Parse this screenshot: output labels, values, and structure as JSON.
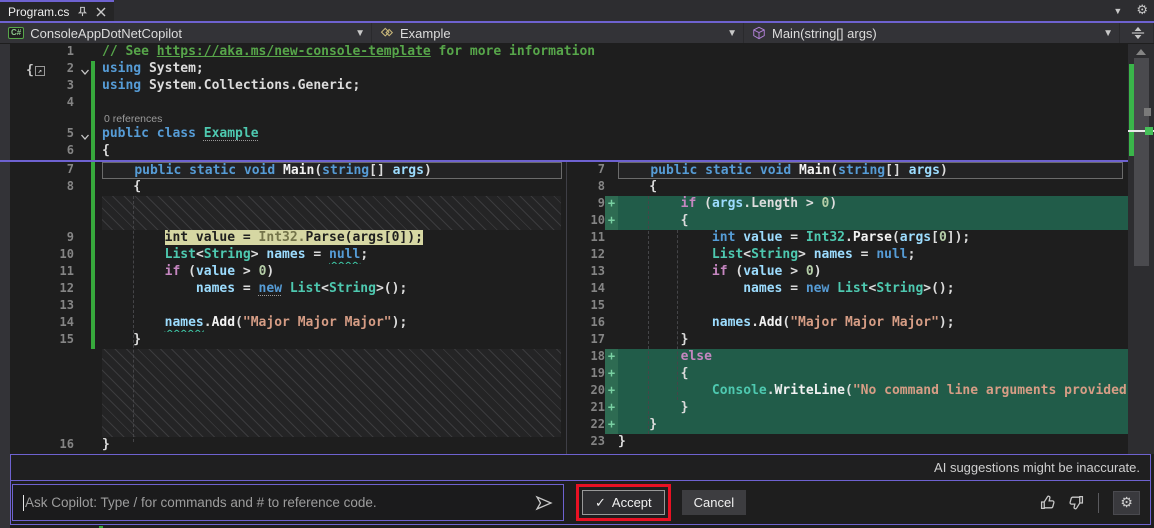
{
  "window": {
    "tab_title": "Program.cs",
    "tab_icons": [
      "pin-icon",
      "close-icon"
    ],
    "tabbar_right_icons": [
      "chevron-down-icon",
      "gear-icon"
    ]
  },
  "navbar": {
    "project": "ConsoleAppDotNetCopilot",
    "project_icon": "C#",
    "class": "Example",
    "class_icon": "class-icon",
    "method": "Main(string[] args)",
    "method_icon": "method-cube-icon",
    "split_icon": "split-editor-icon"
  },
  "editor": {
    "codelens": "0 references",
    "top_lines": [
      {
        "n": "1",
        "tokens": [
          [
            "// See ",
            "cm"
          ],
          [
            "https://aka.ms/new-console-template",
            "link"
          ],
          [
            " for more information",
            "cm"
          ]
        ]
      },
      {
        "n": "2",
        "fold": true,
        "tokens": [
          [
            "using",
            "kw"
          ],
          [
            " System;",
            "id"
          ]
        ]
      },
      {
        "n": "3",
        "tokens": [
          [
            "using",
            "kw"
          ],
          [
            " System.Collections.Generic;",
            "id"
          ]
        ]
      },
      {
        "n": "4",
        "tokens": []
      },
      {
        "lens": true
      },
      {
        "n": "5",
        "fold": true,
        "tokens": [
          [
            "public class ",
            "kw"
          ],
          [
            "Example",
            "type dots"
          ]
        ]
      },
      {
        "n": "6",
        "tokens": [
          [
            "{",
            "id"
          ]
        ]
      }
    ],
    "left_pane": [
      {
        "n": "7",
        "box": true,
        "tokens": [
          [
            "    ",
            "id"
          ],
          [
            "public static void ",
            "kw"
          ],
          [
            "Main",
            "meth"
          ],
          [
            "(",
            "id"
          ],
          [
            "string",
            "kw"
          ],
          [
            "[] ",
            "id"
          ],
          [
            "args",
            "var"
          ],
          [
            ")",
            "id"
          ]
        ]
      },
      {
        "n": "8",
        "tokens": [
          [
            "    {",
            "id"
          ]
        ]
      },
      {
        "hatch": 2
      },
      {
        "n": "9",
        "hl": "yellow",
        "tokens": [
          [
            "        ",
            "id"
          ],
          [
            "int value = ",
            "dk"
          ],
          [
            "Int32.",
            "dkf"
          ],
          [
            "Parse(args[0]);",
            "dk"
          ]
        ]
      },
      {
        "n": "10",
        "tokens": [
          [
            "        ",
            "id"
          ],
          [
            "List",
            "type"
          ],
          [
            "<",
            "id"
          ],
          [
            "String",
            "type"
          ],
          [
            "> ",
            "id"
          ],
          [
            "names",
            "var b"
          ],
          [
            " = ",
            "id"
          ],
          [
            "null",
            "kw sq"
          ],
          [
            ";",
            "id"
          ]
        ]
      },
      {
        "n": "11",
        "tokens": [
          [
            "        ",
            "id"
          ],
          [
            "if",
            "ctrl"
          ],
          [
            " (",
            "id"
          ],
          [
            "value",
            "var"
          ],
          [
            " > ",
            "id"
          ],
          [
            "0",
            "num"
          ],
          [
            ")",
            "id"
          ]
        ]
      },
      {
        "n": "12",
        "tokens": [
          [
            "            ",
            "id"
          ],
          [
            "names",
            "var b"
          ],
          [
            " = ",
            "id"
          ],
          [
            "new",
            "kw dots"
          ],
          [
            " ",
            "id"
          ],
          [
            "List",
            "type"
          ],
          [
            "<",
            "id"
          ],
          [
            "String",
            "type"
          ],
          [
            ">();",
            "id"
          ]
        ]
      },
      {
        "n": "13",
        "tokens": []
      },
      {
        "n": "14",
        "tokens": [
          [
            "        ",
            "id"
          ],
          [
            "names",
            "var b sq"
          ],
          [
            ".",
            "id"
          ],
          [
            "Add",
            "meth"
          ],
          [
            "(",
            "id"
          ],
          [
            "\"Major Major Major\"",
            "str"
          ],
          [
            ");",
            "id"
          ]
        ]
      },
      {
        "n": "15",
        "tokens": [
          [
            "    }",
            "id"
          ]
        ]
      },
      {
        "hatch": 5
      },
      {
        "n": "16",
        "tokens": [
          [
            "}",
            "id"
          ]
        ]
      }
    ],
    "right_pane": [
      {
        "n": "7",
        "box": true,
        "tokens": [
          [
            "    ",
            "id"
          ],
          [
            "public static void ",
            "kw"
          ],
          [
            "Main",
            "meth"
          ],
          [
            "(",
            "id"
          ],
          [
            "string",
            "kw"
          ],
          [
            "[] ",
            "id"
          ],
          [
            "args",
            "var"
          ],
          [
            ")",
            "id"
          ]
        ]
      },
      {
        "n": "8",
        "tokens": [
          [
            "    {",
            "id"
          ]
        ]
      },
      {
        "n": "9",
        "add": true,
        "tokens": [
          [
            "        ",
            "id"
          ],
          [
            "if",
            "ctrl"
          ],
          [
            " (",
            "id"
          ],
          [
            "args",
            "var"
          ],
          [
            ".",
            "id"
          ],
          [
            "Length",
            "id"
          ],
          [
            " > ",
            "id"
          ],
          [
            "0",
            "num"
          ],
          [
            ")",
            "id"
          ]
        ]
      },
      {
        "n": "10",
        "add": true,
        "tokens": [
          [
            "        {",
            "id"
          ]
        ]
      },
      {
        "n": "11",
        "tokens": [
          [
            "            ",
            "id"
          ],
          [
            "int",
            "kw"
          ],
          [
            " ",
            "id"
          ],
          [
            "value",
            "var"
          ],
          [
            " = ",
            "id"
          ],
          [
            "Int32",
            "type"
          ],
          [
            ".",
            "id"
          ],
          [
            "Parse",
            "meth"
          ],
          [
            "(",
            "id"
          ],
          [
            "args",
            "var"
          ],
          [
            "[",
            "id"
          ],
          [
            "0",
            "num"
          ],
          [
            "]);",
            "id"
          ]
        ]
      },
      {
        "n": "12",
        "tokens": [
          [
            "            ",
            "id"
          ],
          [
            "List",
            "type"
          ],
          [
            "<",
            "id"
          ],
          [
            "String",
            "type"
          ],
          [
            "> ",
            "id"
          ],
          [
            "names",
            "var b"
          ],
          [
            " = ",
            "id"
          ],
          [
            "null",
            "kw"
          ],
          [
            ";",
            "id"
          ]
        ]
      },
      {
        "n": "13",
        "tokens": [
          [
            "            ",
            "id"
          ],
          [
            "if",
            "ctrl"
          ],
          [
            " (",
            "id"
          ],
          [
            "value",
            "var"
          ],
          [
            " > ",
            "id"
          ],
          [
            "0",
            "num"
          ],
          [
            ")",
            "id"
          ]
        ]
      },
      {
        "n": "14",
        "tokens": [
          [
            "                ",
            "id"
          ],
          [
            "names",
            "var b"
          ],
          [
            " = ",
            "id"
          ],
          [
            "new",
            "kw"
          ],
          [
            " ",
            "id"
          ],
          [
            "List",
            "type"
          ],
          [
            "<",
            "id"
          ],
          [
            "String",
            "type"
          ],
          [
            ">();",
            "id"
          ]
        ]
      },
      {
        "n": "15",
        "tokens": []
      },
      {
        "n": "16",
        "tokens": [
          [
            "            ",
            "id"
          ],
          [
            "names",
            "var b"
          ],
          [
            ".",
            "id"
          ],
          [
            "Add",
            "meth"
          ],
          [
            "(",
            "id"
          ],
          [
            "\"Major Major Major\"",
            "str"
          ],
          [
            ");",
            "id"
          ]
        ]
      },
      {
        "n": "17",
        "tokens": [
          [
            "        }",
            "id"
          ]
        ]
      },
      {
        "n": "18",
        "add": true,
        "tokens": [
          [
            "        ",
            "id"
          ],
          [
            "else",
            "ctrl"
          ]
        ]
      },
      {
        "n": "19",
        "add": true,
        "tokens": [
          [
            "        {",
            "id"
          ]
        ]
      },
      {
        "n": "20",
        "add": true,
        "tokens": [
          [
            "            ",
            "id"
          ],
          [
            "Console",
            "type"
          ],
          [
            ".",
            "id"
          ],
          [
            "WriteLine",
            "meth"
          ],
          [
            "(",
            "id"
          ],
          [
            "\"No command line arguments provided",
            "str"
          ]
        ]
      },
      {
        "n": "21",
        "add": true,
        "tokens": [
          [
            "        }",
            "id"
          ]
        ]
      },
      {
        "n": "22",
        "add": true,
        "tokens": [
          [
            "    }",
            "id"
          ]
        ]
      },
      {
        "n": "23",
        "tokens": [
          [
            "}",
            "id"
          ]
        ]
      }
    ]
  },
  "copilot": {
    "disclaimer": "AI suggestions might be inaccurate.",
    "input_placeholder": "Ask Copilot: Type / for commands and # to reference code.",
    "accept_label": "Accept",
    "accept_check": "✓",
    "cancel_label": "Cancel",
    "icons": [
      "send-icon",
      "thumbs-up-icon",
      "thumbs-down-icon",
      "gear-icon"
    ]
  },
  "colors": {
    "accent_purple": "#6e62d0",
    "added_line_green": "#215c49",
    "changed_line_yellow": "#d6d7a3",
    "annotation_red": "#e81123",
    "change_bar_green": "#37a93c",
    "editor_bg": "#1e1e1e"
  }
}
